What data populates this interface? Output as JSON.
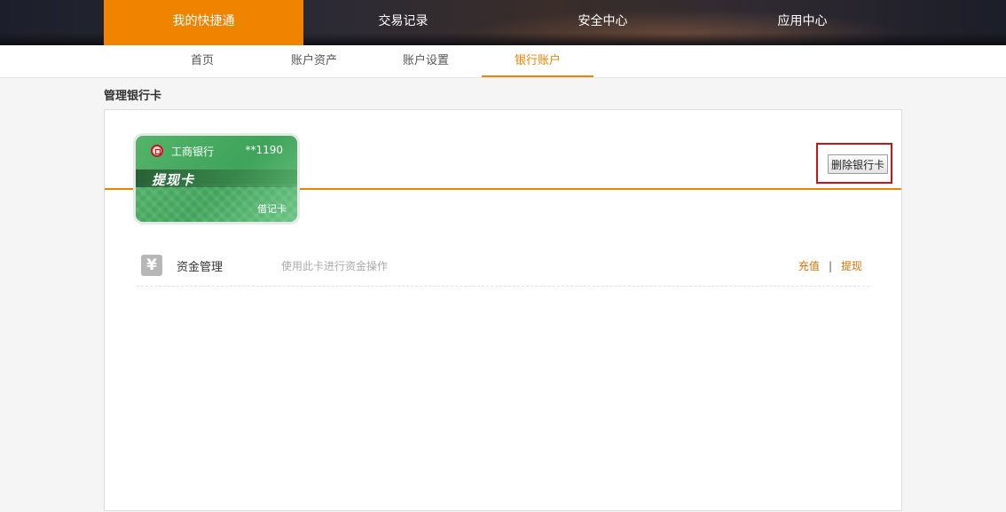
{
  "top_nav": {
    "items": [
      {
        "label": "我的快捷通",
        "active": true
      },
      {
        "label": "交易记录",
        "active": false
      },
      {
        "label": "安全中心",
        "active": false
      },
      {
        "label": "应用中心",
        "active": false
      }
    ]
  },
  "sub_nav": {
    "tabs": [
      {
        "label": "首页",
        "active": false
      },
      {
        "label": "账户资产",
        "active": false
      },
      {
        "label": "账户设置",
        "active": false
      },
      {
        "label": "银行账户",
        "active": true
      }
    ]
  },
  "page_title": "管理银行卡",
  "card": {
    "bank_name": "工商银行",
    "card_number": "**1190",
    "card_type": "提现卡",
    "card_kind": "借记卡",
    "logo_icon": "icbc-logo-icon"
  },
  "delete_button": "删除银行卡",
  "fund_management": {
    "icon": "yuan-icon",
    "icon_glyph": "¥",
    "title": "资金管理",
    "description": "使用此卡进行资金操作",
    "actions": {
      "recharge": "充值",
      "separator": "|",
      "withdraw": "提现"
    }
  },
  "colors": {
    "accent": "#f08300",
    "highlight_frame": "#c9141c",
    "card_green": "#4aad62"
  }
}
